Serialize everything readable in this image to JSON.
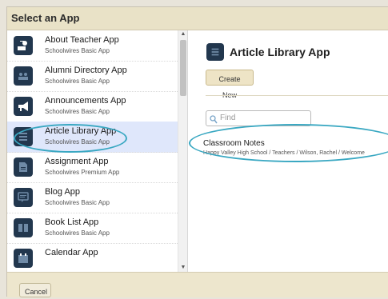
{
  "dialog": {
    "title": "Select an App"
  },
  "app_list": [
    {
      "name": "About Teacher App",
      "edition": "Schoolwires Basic App",
      "icon": "teacher-icon"
    },
    {
      "name": "Alumni Directory App",
      "edition": "Schoolwires Basic App",
      "icon": "alumni-icon"
    },
    {
      "name": "Announcements App",
      "edition": "Schoolwires Basic App",
      "icon": "megaphone-icon"
    },
    {
      "name": "Article Library App",
      "edition": "Schoolwires Basic App",
      "icon": "list-icon",
      "selected": true
    },
    {
      "name": "Assignment App",
      "edition": "Schoolwires Premium App",
      "icon": "document-icon"
    },
    {
      "name": "Blog App",
      "edition": "Schoolwires Basic App",
      "icon": "speech-bubble-icon"
    },
    {
      "name": "Book List App",
      "edition": "Schoolwires Basic App",
      "icon": "book-icon"
    },
    {
      "name": "Calendar App",
      "edition": "",
      "icon": "calendar-icon"
    }
  ],
  "detail": {
    "app_title": "Article Library App",
    "create_button": "Create New",
    "find_placeholder": "Find",
    "results": [
      {
        "title": "Classroom Notes",
        "path": "Happy Valley High School / Teachers / Wilson, Rachel / Welcome"
      }
    ]
  },
  "footer": {
    "cancel_button": "Cancel"
  },
  "colors": {
    "icon_bg": "#22374e",
    "selected_bg": "#dfe7fb",
    "callout": "#3aa8c2",
    "title_bar": "#e9e2c7"
  }
}
